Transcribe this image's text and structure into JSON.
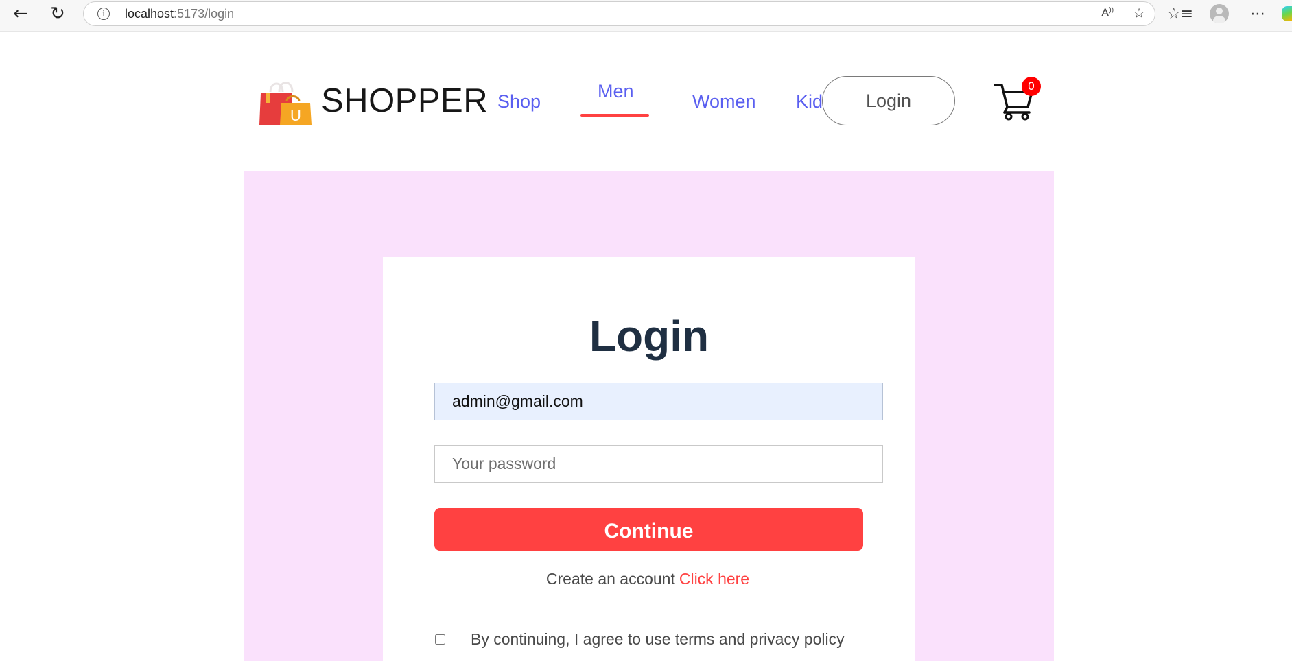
{
  "browser": {
    "url_host": "localhost",
    "url_path": ":5173/login"
  },
  "navbar": {
    "brand": "SHOPPER",
    "menu": {
      "shop": "Shop",
      "men": "Men",
      "women": "Women",
      "kids": "Kids"
    },
    "active_item": "men",
    "login_label": "Login",
    "cart_count": "0"
  },
  "login": {
    "title": "Login",
    "email_value": "admin@gmail.com",
    "password_placeholder": "Your password",
    "continue_label": "Continue",
    "create_account_text": "Create an account",
    "click_here_label": "Click here",
    "agree_text": "By continuing, I agree to use terms and privacy policy"
  },
  "colors": {
    "accent": "#ff4141",
    "menu_link": "#5a5ff0",
    "login_background": "#fae1fc",
    "title": "#1f2f42"
  },
  "icons": [
    "back-icon",
    "reload-icon",
    "info-icon",
    "read-aloud-icon",
    "favorite-star-icon",
    "favorites-icon",
    "profile-icon",
    "more-icon",
    "copilot-icon",
    "shopping-bag-logo-icon",
    "cart-icon"
  ]
}
